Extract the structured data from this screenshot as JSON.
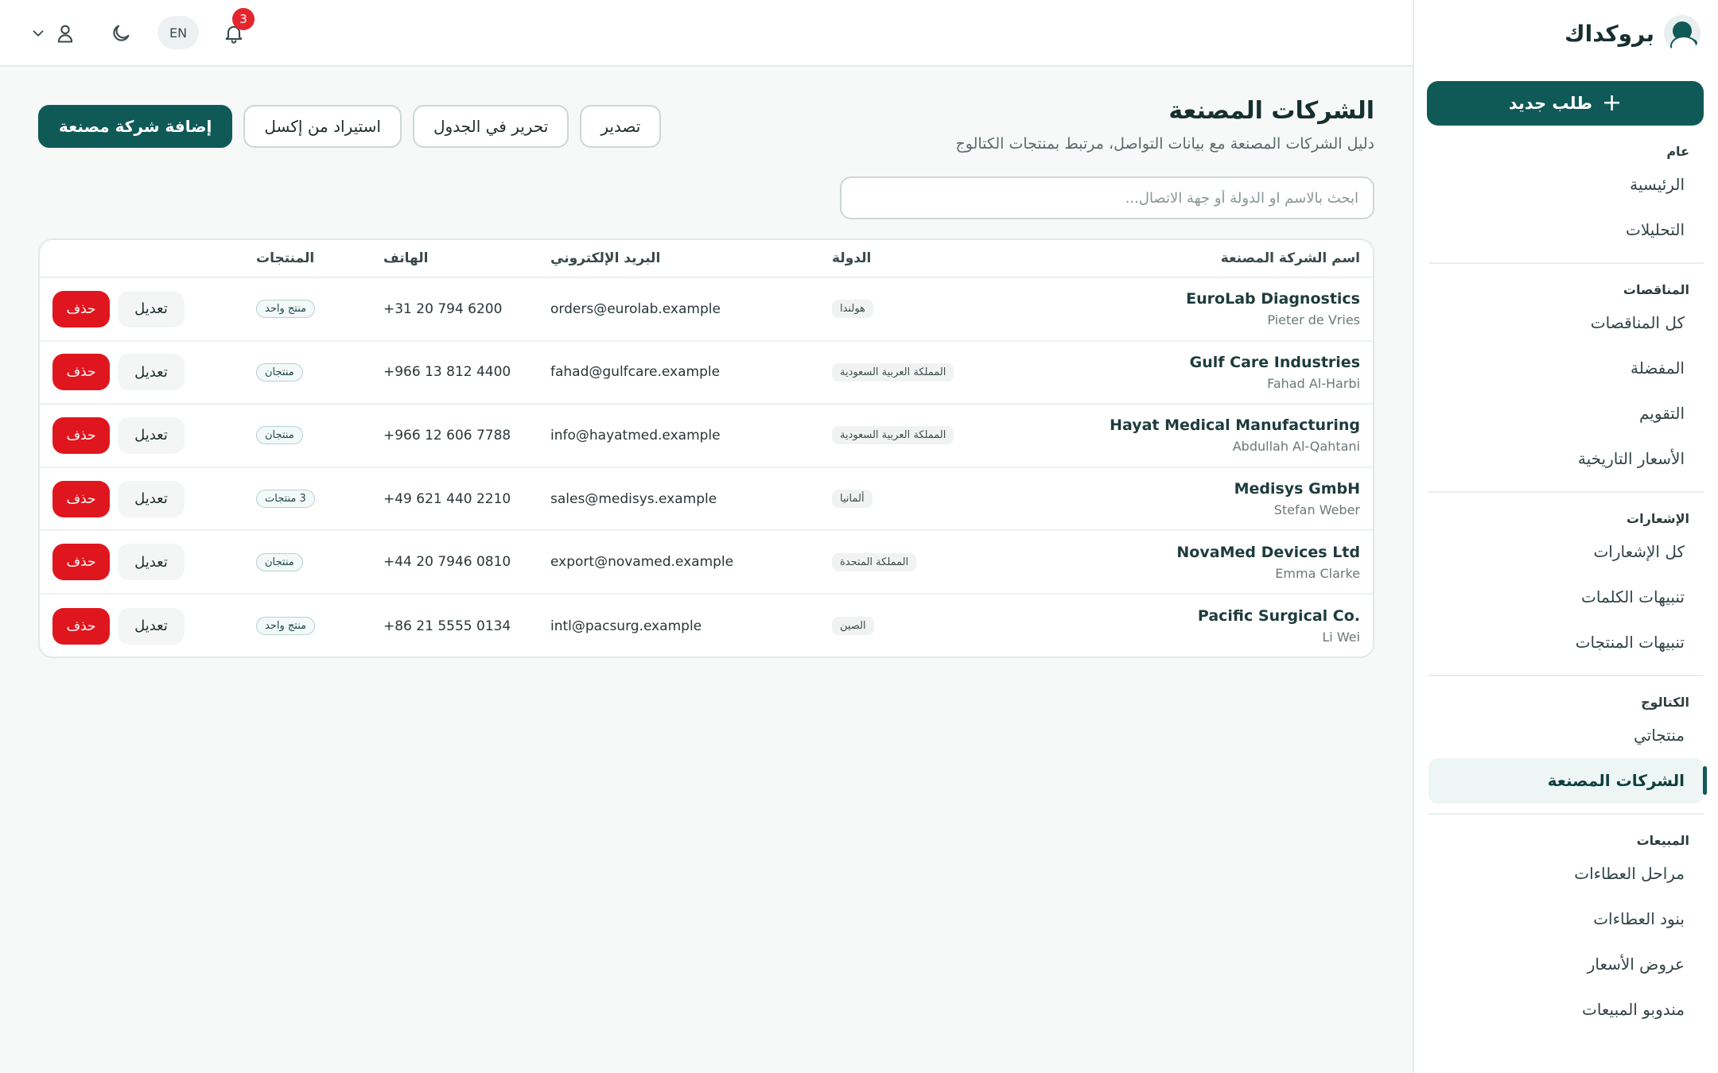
{
  "brand": {
    "name": "بروكداك"
  },
  "sidebar": {
    "new_request_label": "طلب جديد",
    "groups": [
      {
        "label": "عام",
        "items": [
          "الرئيسية",
          "التحليلات"
        ]
      },
      {
        "label": "المناقصات",
        "items": [
          "كل المناقصات",
          "المفضلة",
          "التقويم",
          "الأسعار التاريخية"
        ]
      },
      {
        "label": "الإشعارات",
        "items": [
          "كل الإشعارات",
          "تنبيهات الكلمات",
          "تنبيهات المنتجات"
        ]
      },
      {
        "label": "الكتالوج",
        "items": [
          "منتجاتي",
          "الشركات المصنعة"
        ]
      },
      {
        "label": "المبيعات",
        "items": [
          "مراحل العطاءات",
          "بنود العطاءات",
          "عروض الأسعار",
          "مندوبو المبيعات"
        ]
      }
    ],
    "active_item": "الشركات المصنعة"
  },
  "topbar": {
    "lang": "EN",
    "notification_count": "3",
    "icons": [
      "bell-icon",
      "moon-icon",
      "user-icon",
      "chevron-down-icon"
    ]
  },
  "page": {
    "title": "الشركات المصنعة",
    "subtitle": "دليل الشركات المصنعة مع بيانات التواصل، مرتبط بمنتجات الكتالوج",
    "actions": {
      "export": "تصدير",
      "edit_table": "تحرير في الجدول",
      "import_excel": "استيراد من إكسل",
      "add": "إضافة شركة مصنعة"
    },
    "search_placeholder": "ابحث بالاسم او الدولة أو جهة الاتصال..."
  },
  "table": {
    "headers": {
      "name": "اسم الشركة المصنعة",
      "country": "الدولة",
      "email": "البريد الإلكتروني",
      "phone": "الهاتف",
      "products": "المنتجات"
    },
    "edit_label": "تعديل",
    "delete_label": "حذف",
    "rows": [
      {
        "name": "EuroLab Diagnostics",
        "contact": "Pieter de Vries",
        "country": "هولندا",
        "email": "orders@eurolab.example",
        "phone": "+31 20 794 6200",
        "products": "منتج واحد"
      },
      {
        "name": "Gulf Care Industries",
        "contact": "Fahad Al-Harbi",
        "country": "المملكة العربية السعودية",
        "email": "fahad@gulfcare.example",
        "phone": "+966 13 812 4400",
        "products": "منتجان"
      },
      {
        "name": "Hayat Medical Manufacturing",
        "contact": "Abdullah Al-Qahtani",
        "country": "المملكة العربية السعودية",
        "email": "info@hayatmed.example",
        "phone": "+966 12 606 7788",
        "products": "منتجان"
      },
      {
        "name": "Medisys GmbH",
        "contact": "Stefan Weber",
        "country": "ألمانيا",
        "email": "sales@medisys.example",
        "phone": "+49 621 440 2210",
        "products": "3 منتجات"
      },
      {
        "name": "NovaMed Devices Ltd",
        "contact": "Emma Clarke",
        "country": "المملكة المتحدة",
        "email": "export@novamed.example",
        "phone": "+44 20 7946 0810",
        "products": "منتجان"
      },
      {
        "name": "Pacific Surgical Co.",
        "contact": "Li Wei",
        "country": "الصين",
        "email": "intl@pacsurg.example",
        "phone": "+86 21 5555 0134",
        "products": "منتج واحد"
      }
    ]
  }
}
